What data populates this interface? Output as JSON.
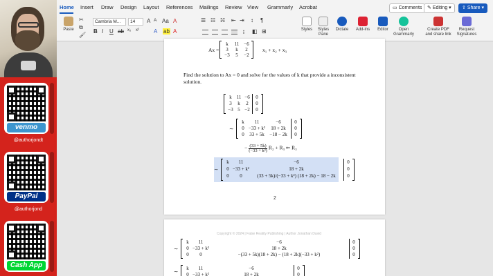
{
  "ribbon": {
    "tabs": [
      "Home",
      "Insert",
      "Draw",
      "Design",
      "Layout",
      "References",
      "Mailings",
      "Review",
      "View",
      "Grammarly",
      "Acrobat"
    ],
    "active_tab": "Home",
    "comments_label": "Comments",
    "editing_label": "Editing",
    "share_label": "Share",
    "font_name": "Cambria M...",
    "font_size": "14",
    "paste_label": "Paste",
    "styles_label": "Styles",
    "styles_pane_label": "Styles Pane",
    "dictate_label": "Dictate",
    "addins_label": "Add-ins",
    "editor_label": "Editor",
    "open_grammarly_label": "Open Grammarly",
    "create_pdf_label": "Create PDF and share link",
    "request_signatures_label": "Request Signatures",
    "bold": "B",
    "italic": "I",
    "underline": "U"
  },
  "sidebar": {
    "venmo": {
      "brand": "venmo",
      "handle": "@authorjondt",
      "color": "#3d95ce"
    },
    "paypal": {
      "brand": "PayPal",
      "handle": "@authorjond",
      "color": "#003087"
    },
    "cashapp": {
      "brand": "Cash App",
      "handle": "",
      "color": "#00d632"
    }
  },
  "document": {
    "eq_top_lhs": "Ax =",
    "eq_top_rhs": "x₁ + x₂ + x₃",
    "problem_text": "Find the solution to Ax = 0 and solve for the values of k that provide a inconsistent solution.",
    "row_op": "R₂ + R₃ ⇐ R₃",
    "row_op_coef_num": "(33 + 5k)",
    "row_op_coef_den": "(−33 + k²)",
    "page_number": "2",
    "copyright": "Copyright © 2024 | False Reality Publishing | Author Jonathan David",
    "m1": [
      [
        "k",
        "11",
        "−6",
        "0"
      ],
      [
        "3",
        "k",
        "2",
        "0"
      ],
      [
        "−3",
        "5",
        "−2",
        "0"
      ]
    ],
    "m3": [
      [
        "k",
        "11",
        "−6",
        "0"
      ],
      [
        "0",
        "−33 + k²",
        "18 + 2k",
        "0"
      ],
      [
        "0",
        "33 + 5k",
        "−18 − 2k",
        "0"
      ]
    ],
    "m4": [
      [
        "k",
        "11",
        "−6",
        "0"
      ],
      [
        "0",
        "−33 + k²",
        "18 + 2k",
        "0"
      ],
      [
        "0",
        "0",
        "(33 + 5k)/(−33 + k²) (18 + 2k) − 18 − 2k",
        "0"
      ]
    ],
    "m5": [
      [
        "k",
        "11",
        "−6",
        "0"
      ],
      [
        "0",
        "−33 + k²",
        "18 + 2k",
        "0"
      ],
      [
        "0",
        "0",
        "−(33 + 5k)(18 + 2k) − (18 + 2k)(−33 + k²)",
        "0"
      ]
    ],
    "m6": [
      [
        "k",
        "11",
        "−6",
        "0"
      ],
      [
        "0",
        "−33 + k²",
        "18 + 2k",
        "0"
      ]
    ]
  },
  "colors": {
    "accent": "#185abd",
    "sidebar_red": "#d4231c",
    "selection": "#aec6ec"
  }
}
